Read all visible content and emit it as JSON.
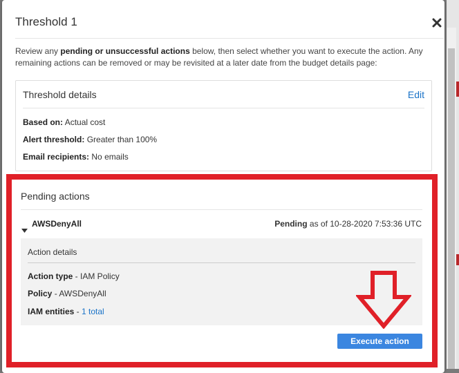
{
  "modal": {
    "title": "Threshold 1",
    "intro_prefix": "Review any ",
    "intro_bold": "pending or unsuccessful actions",
    "intro_suffix": " below, then select whether you want to execute the action. Any remaining actions can be removed or may be revisited at a later date from the budget details page:"
  },
  "threshold_details": {
    "title": "Threshold details",
    "edit_label": "Edit",
    "rows": [
      {
        "label": "Based on:",
        "value": "Actual cost"
      },
      {
        "label": "Alert threshold:",
        "value": "Greater than 100%"
      },
      {
        "label": "Email recipients:",
        "value": "No emails"
      }
    ]
  },
  "pending_actions": {
    "title": "Pending actions",
    "action_name": "AWSDenyAll",
    "status_label": "Pending",
    "status_suffix": "as of 10-28-2020 7:53:36 UTC",
    "details": {
      "title": "Action details",
      "action_type_label": "Action type",
      "action_type_value": "IAM Policy",
      "policy_label": "Policy",
      "policy_value": "AWSDenyAll",
      "entities_label": "IAM entities",
      "entities_link": "1 total",
      "separator": " - "
    },
    "execute_label": "Execute action"
  },
  "icons": {
    "close": "close-icon",
    "caret": "caret-down-icon",
    "annotation_arrow": "down-arrow-annotation"
  },
  "colors": {
    "accent": "#3b86e0",
    "link": "#1a73c8",
    "highlight": "#e02028"
  }
}
